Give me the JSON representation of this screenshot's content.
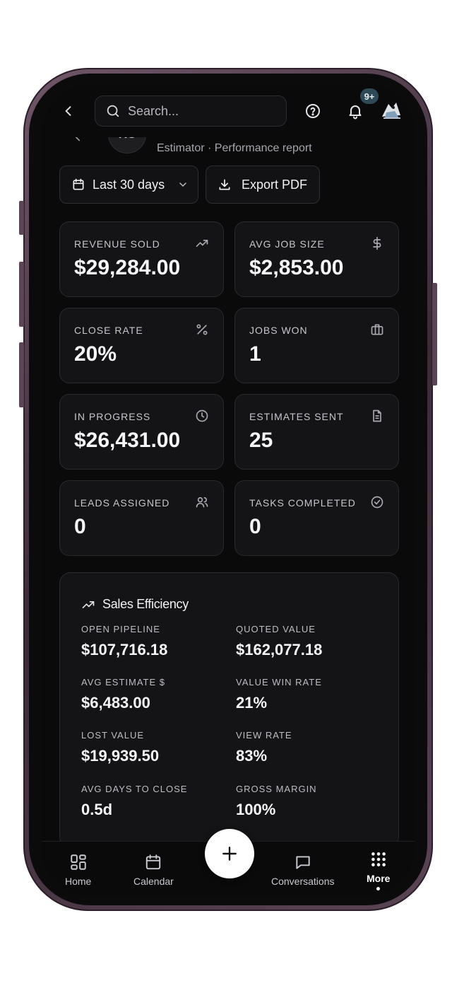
{
  "topbar": {
    "search_placeholder": "Search...",
    "notification_badge": "9+"
  },
  "header": {
    "avatar_initials": "RC",
    "subtitle": "Estimator · Performance report"
  },
  "actions": {
    "date_range_label": "Last 30 days",
    "export_label": "Export PDF"
  },
  "stats": [
    {
      "label": "REVENUE SOLD",
      "value": "$29,284.00",
      "icon": "trending-up-icon"
    },
    {
      "label": "AVG JOB SIZE",
      "value": "$2,853.00",
      "icon": "dollar-icon"
    },
    {
      "label": "CLOSE RATE",
      "value": "20%",
      "icon": "percent-icon"
    },
    {
      "label": "JOBS WON",
      "value": "1",
      "icon": "briefcase-icon"
    },
    {
      "label": "IN PROGRESS",
      "value": "$26,431.00",
      "icon": "clock-icon"
    },
    {
      "label": "ESTIMATES SENT",
      "value": "25",
      "icon": "document-icon"
    },
    {
      "label": "LEADS ASSIGNED",
      "value": "0",
      "icon": "users-icon"
    },
    {
      "label": "TASKS COMPLETED",
      "value": "0",
      "icon": "check-circle-icon"
    }
  ],
  "efficiency": {
    "title": "Sales Efficiency",
    "metrics": [
      {
        "label": "OPEN PIPELINE",
        "value": "$107,716.18"
      },
      {
        "label": "QUOTED VALUE",
        "value": "$162,077.18"
      },
      {
        "label": "AVG ESTIMATE $",
        "value": "$6,483.00"
      },
      {
        "label": "VALUE WIN RATE",
        "value": "21%"
      },
      {
        "label": "LOST VALUE",
        "value": "$19,939.50"
      },
      {
        "label": "VIEW RATE",
        "value": "83%"
      },
      {
        "label": "AVG DAYS TO CLOSE",
        "value": "0.5d"
      },
      {
        "label": "GROSS MARGIN",
        "value": "100%"
      }
    ]
  },
  "nav": {
    "home": "Home",
    "calendar": "Calendar",
    "conversations": "Conversations",
    "more": "More"
  },
  "colors": {
    "background": "#0a0a0b",
    "card": "#141416",
    "border": "#2a2a2e",
    "text": "#f2f2f4",
    "badge": "#2e4a57"
  }
}
